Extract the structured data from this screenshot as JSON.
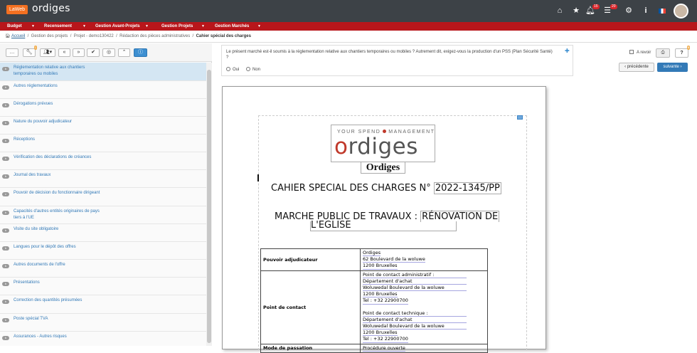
{
  "topbar": {
    "logo": "LaWeb",
    "app_name": "ordiges",
    "notifications_count": "15",
    "tasks_count": "20"
  },
  "menu": [
    {
      "label": "Budget"
    },
    {
      "label": "Recensement"
    },
    {
      "label": "Gestion Avant-Projets"
    },
    {
      "label": "Gestion Projets"
    },
    {
      "label": "Gestion Marchés"
    }
  ],
  "breadcrumb": {
    "home": "Accueil",
    "items": [
      "Gestion des projets",
      "Projet - demo130422",
      "Rédaction des pièces administratives"
    ],
    "current": "Cahier spécial des charges",
    "separator": "/"
  },
  "toolbar": {
    "badge": "1",
    "buttons": [
      "…",
      "wrench",
      "users",
      "«",
      "»",
      "check",
      "eye-slash",
      "up",
      "info"
    ]
  },
  "sections": [
    {
      "badge": "b",
      "label": "Réglementation relative aux chantiers temporaires ou mobiles",
      "selected": true
    },
    {
      "badge": "b",
      "label": "Autres réglementations"
    },
    {
      "badge": "b",
      "label": "Dérogations prévues"
    },
    {
      "badge": "b",
      "label": "Nature du pouvoir adjudicateur"
    },
    {
      "badge": "b",
      "label": "Réceptions"
    },
    {
      "badge": "b",
      "label": "Vérification des déclarations de créances"
    },
    {
      "badge": "b",
      "label": "Journal des travaux"
    },
    {
      "badge": "c",
      "label": "Pouvoir de décision du fonctionnaire dirigeant"
    },
    {
      "badge": "b",
      "label": "Capacités d'autres entités originaires de pays tiers à l'UE"
    },
    {
      "badge": "b",
      "label": "Visite du site obligatoire"
    },
    {
      "badge": "b",
      "label": "Langues pour le dépôt des offres"
    },
    {
      "badge": "b",
      "label": "Autres documents de l'offre"
    },
    {
      "badge": "b",
      "label": "Présentations"
    },
    {
      "badge": "b",
      "label": "Correction des quantités présumées"
    },
    {
      "badge": "b",
      "label": "Poste spécial TVA"
    },
    {
      "badge": "b",
      "label": "Assurances - Autres risques"
    }
  ],
  "question": {
    "text": "Le présent marché est-il soumis à la réglementation relative aux chantiers temporaires ou mobiles ? Autrement dit, exigez-vous la production d'un PSS (Plan Sécurité Santé) ?",
    "options": [
      "Oui",
      "Non"
    ],
    "a_revoir": "A revoir",
    "help_badge": "0",
    "prev": "précédente",
    "next": "suivante"
  },
  "document": {
    "slogan_left": "YOUR SPEND",
    "slogan_right": "MANAGEMENT",
    "brand": "rdiges",
    "brand_o": "o",
    "company": "Ordiges",
    "cahier_label": "CAHIER SPECIAL DES CHARGES N°",
    "cahier_number": "2022-1345/PP",
    "marche_label": "MARCHE PUBLIC DE TRAVAUX :",
    "marche_title_1": "RÉNOVATION DE",
    "marche_title_2": "L'EGLISE",
    "rows": [
      {
        "label": "Pouvoir adjudicateur",
        "lines": [
          "Ordiges",
          "62 Boulevard de la woluwe",
          "1200 Bruxelles"
        ]
      },
      {
        "label": "Point de contact",
        "lines": [
          "Point de contact administratif :",
          "Département d'achat",
          "Woluwedal Boulevard de la woluwe",
          "1200 Bruxelles",
          "Tel : +32 22900700",
          "",
          "Point de contact technique :",
          "Département d'achat",
          "Woluwedal Boulevard de la woluwe",
          "1200 Bruxelles",
          "Tel : +32 22900700"
        ]
      },
      {
        "label": "Mode de passation",
        "lines": [
          "Procédure ouverte"
        ]
      }
    ]
  }
}
